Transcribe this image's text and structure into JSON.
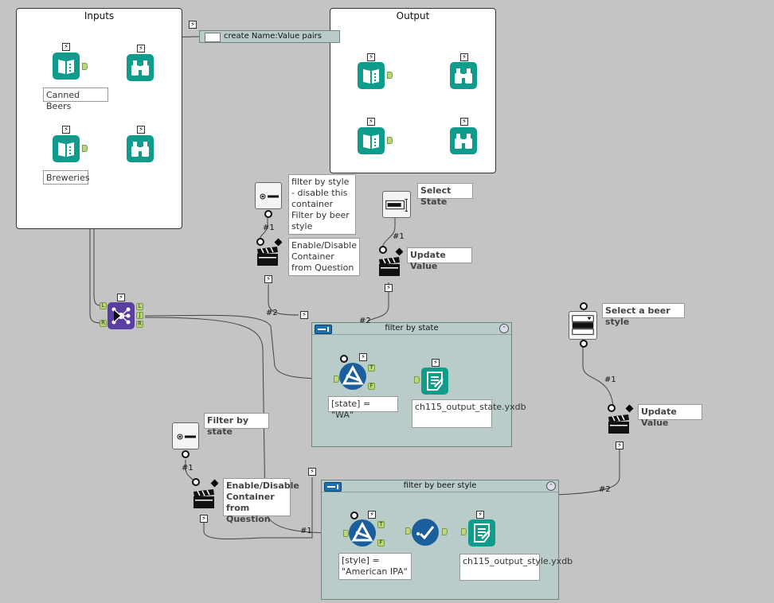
{
  "containers": {
    "inputs": {
      "title": "Inputs"
    },
    "output": {
      "title": "Output"
    },
    "filter_state": {
      "title": "filter by state"
    },
    "filter_style": {
      "title": "filter by beer style"
    }
  },
  "comment": {
    "text": "create Name:Value pairs"
  },
  "tool_labels": {
    "canned_beers": "Canned Beers",
    "breweries": "Breweries",
    "filter_by_style_question": "filter by style - disable this container Filter by beer style",
    "enable_disable_1": "Enable/Disable Container from Question",
    "select_state": "Select State",
    "update_value_1": "Update Value",
    "select_beer_style": "Select a beer style",
    "update_value_2": "Update Value",
    "filter_by_state_question": "Filter by state",
    "enable_disable_2": "Enable/Disable Container from Question",
    "state_expr": "[state] = \"WA\"",
    "output_state": "ch115_output_state.yxdb",
    "style_expr": "[style] = \"American IPA\"",
    "output_style": "ch115_output_style.yxdb"
  },
  "connection_labels": {
    "c1": "#1",
    "c2": "#1",
    "c3": "#2",
    "c4": "#2",
    "c5": "#1",
    "c6": "#2",
    "c7": "#1",
    "c8": "#1"
  },
  "anchors": {
    "L": "L",
    "R": "R",
    "J": "J",
    "T": "T",
    "F": "F"
  },
  "glyphs": {
    "bolt": "⚡",
    "collapse": "⌃"
  },
  "colors": {
    "tool_teal": "#0f9c8c",
    "join_purple": "#5a3ea0",
    "filter_navy": "#1a5f9c",
    "container_teal": "#b9ccca",
    "canvas": "#c4c4c4"
  }
}
